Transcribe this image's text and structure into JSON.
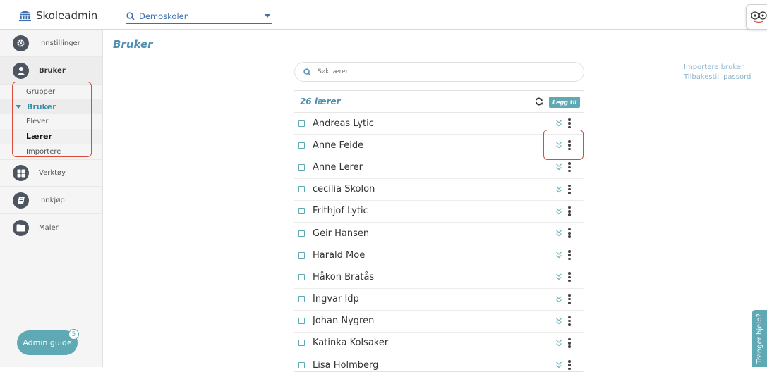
{
  "app": {
    "title": "Skoleadmin"
  },
  "school": {
    "selected": "Demoskolen"
  },
  "sidebar": {
    "items": [
      {
        "label": "Innstillinger"
      },
      {
        "label": "Bruker"
      },
      {
        "label": "Verktøy"
      },
      {
        "label": "Innkjøp"
      },
      {
        "label": "Maler"
      }
    ],
    "bruker_sub": {
      "grupper": "Grupper",
      "bruker": "Bruker",
      "elever": "Elever",
      "laerer": "Lærer",
      "importere": "Importere"
    },
    "admin_guide": {
      "label": "Admin guide",
      "badge": "5"
    }
  },
  "page": {
    "title": "Bruker"
  },
  "right_links": {
    "import": "Importere bruker",
    "reset": "Tilbakestill passord"
  },
  "search": {
    "placeholder": "Søk lærer",
    "value": ""
  },
  "list": {
    "count_label": "26 lærer",
    "add_label": "Legg til",
    "users": [
      "Andreas Lytic",
      "Anne Feide",
      "Anne Lerer",
      "cecilia Skolon",
      "Frithjof Lytic",
      "Geir Hansen",
      "Harald Moe",
      "Håkon Bratås",
      "Ingvar Idp",
      "Johan Nygren",
      "Katinka Kolsaker",
      "Lisa Holmberg"
    ]
  },
  "help": {
    "label": "Trenger hjelp?"
  },
  "colors": {
    "accent": "#5ea9b4",
    "title": "#4e8fb1",
    "annotation": "#d94b3a",
    "link": "#3b6fb0"
  }
}
